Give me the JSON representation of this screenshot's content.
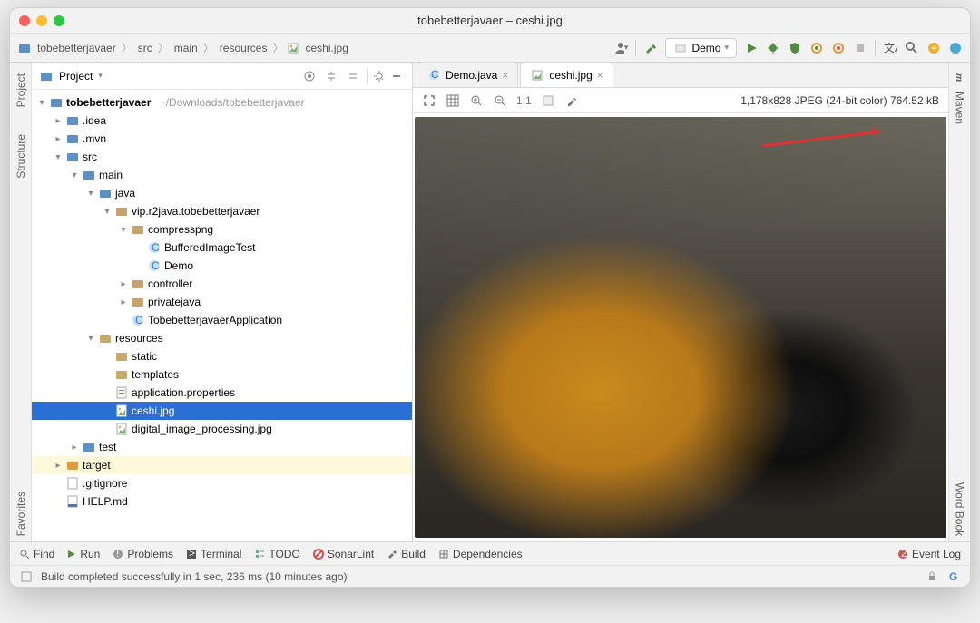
{
  "window": {
    "title": "tobebetterjavaer – ceshi.jpg"
  },
  "breadcrumbs": [
    "tobebetterjavaer",
    "src",
    "main",
    "resources",
    "ceshi.jpg"
  ],
  "runConfig": {
    "label": "Demo"
  },
  "leftTabs": [
    "Project",
    "Structure",
    "Favorites"
  ],
  "rightTabs": [
    "Maven",
    "Word Book"
  ],
  "projectPanel": {
    "title": "Project"
  },
  "tree": {
    "root": {
      "name": "tobebetterjavaer",
      "path": "~/Downloads/tobebetterjavaer"
    },
    "idea": ".idea",
    "mvn": ".mvn",
    "src": "src",
    "main": "main",
    "java": "java",
    "pkg": "vip.r2java.tobebetterjavaer",
    "compresspng": "compresspng",
    "bufferedImageTest": "BufferedImageTest",
    "demoClass": "Demo",
    "controller": "controller",
    "privatejava": "privatejava",
    "appClass": "TobebetterjavaerApplication",
    "resources": "resources",
    "static": "static",
    "templates": "templates",
    "appProps": "application.properties",
    "ceshi": "ceshi.jpg",
    "digital": "digital_image_processing.jpg",
    "test": "test",
    "target": "target",
    "gitignore": ".gitignore",
    "helpmd": "HELP.md"
  },
  "editorTabs": [
    {
      "label": "Demo.java",
      "active": false
    },
    {
      "label": "ceshi.jpg",
      "active": true
    }
  ],
  "imageInfo": "1,178x828 JPEG (24-bit color) 764.52 kB",
  "imageToolbar": {
    "ratio": "1:1"
  },
  "bottomTools": {
    "find": "Find",
    "run": "Run",
    "problems": "Problems",
    "terminal": "Terminal",
    "todo": "TODO",
    "sonarlint": "SonarLint",
    "build": "Build",
    "dependencies": "Dependencies",
    "eventLog": "Event Log"
  },
  "status": {
    "message": "Build completed successfully in 1 sec, 236 ms (10 minutes ago)"
  }
}
